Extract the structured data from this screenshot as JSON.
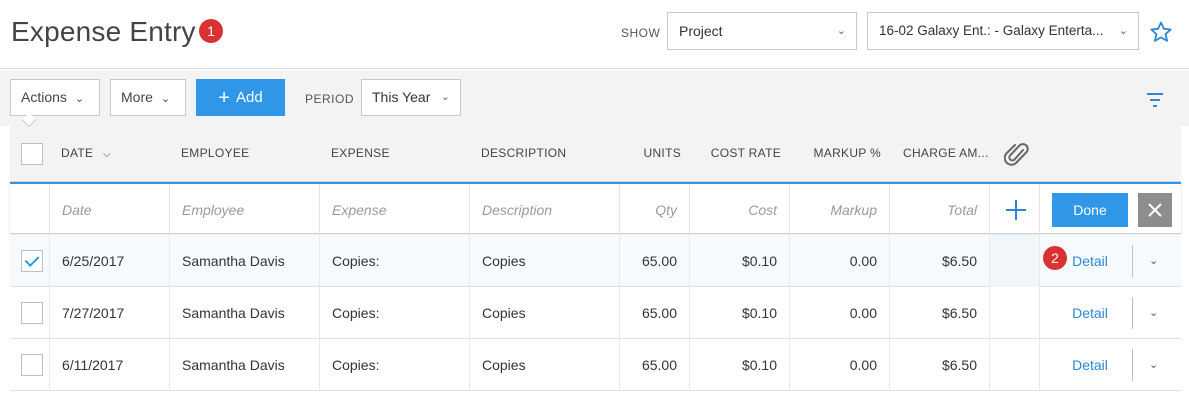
{
  "header": {
    "title": "Expense Entry",
    "badge": "1",
    "show_label": "SHOW",
    "show_value": "Project",
    "project_value": "16-02 Galaxy Ent.: - Galaxy Enterta..."
  },
  "toolbar": {
    "actions_label": "Actions",
    "more_label": "More",
    "add_label": "Add",
    "period_label": "PERIOD",
    "period_value": "This Year"
  },
  "columns": {
    "date": "DATE",
    "employee": "EMPLOYEE",
    "expense": "EXPENSE",
    "description": "DESCRIPTION",
    "units": "UNITS",
    "cost_rate": "COST RATE",
    "markup": "MARKUP %",
    "charge": "CHARGE AM..."
  },
  "entry_row": {
    "date": "Date",
    "employee": "Employee",
    "expense": "Expense",
    "description": "Description",
    "qty": "Qty",
    "cost": "Cost",
    "markup": "Markup",
    "total": "Total",
    "done_label": "Done"
  },
  "rows": [
    {
      "checked": true,
      "date": "6/25/2017",
      "employee": "Samantha Davis",
      "expense": "Copies:",
      "description": "Copies",
      "units": "65.00",
      "cost_rate": "$0.10",
      "markup": "0.00",
      "charge": "$6.50",
      "detail": "Detail"
    },
    {
      "checked": false,
      "date": "7/27/2017",
      "employee": "Samantha Davis",
      "expense": "Copies:",
      "description": "Copies",
      "units": "65.00",
      "cost_rate": "$0.10",
      "markup": "0.00",
      "charge": "$6.50",
      "detail": "Detail"
    },
    {
      "checked": false,
      "date": "6/11/2017",
      "employee": "Samantha Davis",
      "expense": "Copies:",
      "description": "Copies",
      "units": "65.00",
      "cost_rate": "$0.10",
      "markup": "0.00",
      "charge": "$6.50",
      "detail": "Detail"
    }
  ],
  "callout_badge": "2",
  "colors": {
    "accent": "#2f96e8",
    "badge": "#d83232"
  },
  "icons": [
    "star-icon",
    "filter-icon",
    "paperclip-icon",
    "plus-icon",
    "close-icon",
    "chevron-down-icon",
    "sort-down-icon"
  ]
}
